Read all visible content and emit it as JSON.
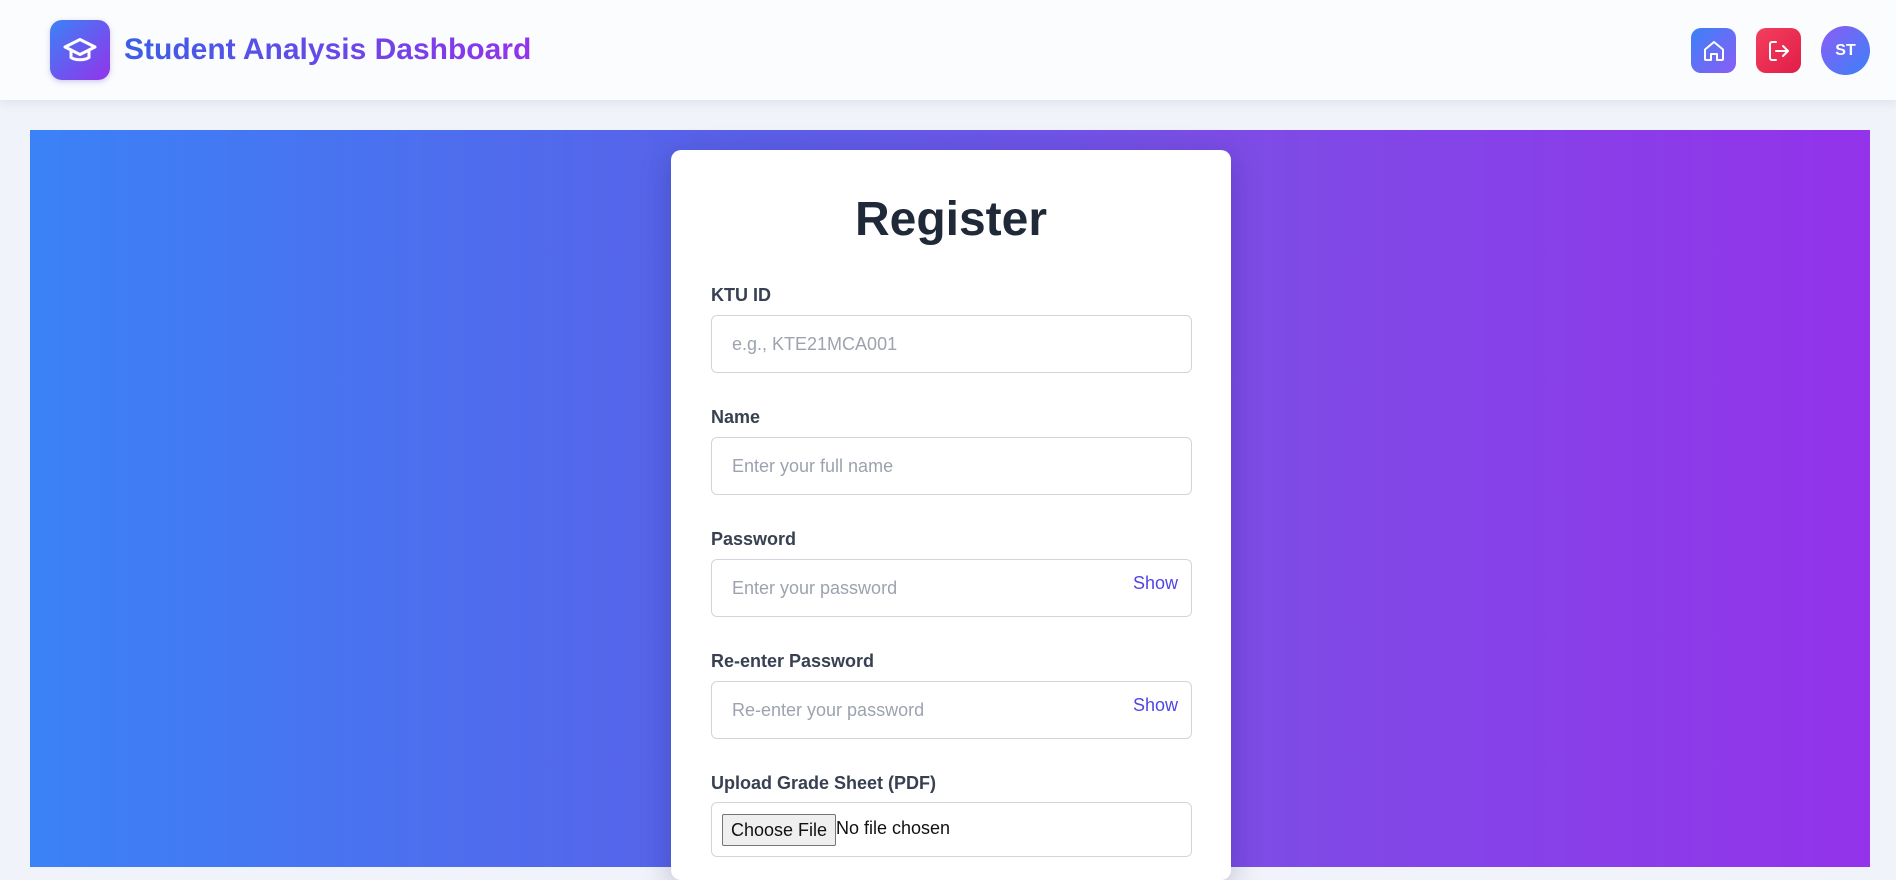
{
  "header": {
    "title": "Student Analysis Dashboard",
    "logo_icon": "graduation-cap-icon",
    "home_icon": "home-icon",
    "logout_icon": "logout-icon",
    "avatar_initials": "ST"
  },
  "colors": {
    "gradient_start": "#3b82f6",
    "gradient_end": "#9333ea",
    "logout": "#e11d48",
    "link": "#4f46e5"
  },
  "form": {
    "title": "Register",
    "ktu_id": {
      "label": "KTU ID",
      "placeholder": "e.g., KTE21MCA001",
      "value": ""
    },
    "name": {
      "label": "Name",
      "placeholder": "Enter your full name",
      "value": ""
    },
    "password": {
      "label": "Password",
      "placeholder": "Enter your password",
      "toggle": "Show",
      "value": ""
    },
    "confirm_password": {
      "label": "Re-enter Password",
      "placeholder": "Re-enter your password",
      "toggle": "Show",
      "value": ""
    },
    "grade_sheet": {
      "label": "Upload Grade Sheet (PDF)",
      "button": "Choose File",
      "status": "No file chosen"
    }
  }
}
